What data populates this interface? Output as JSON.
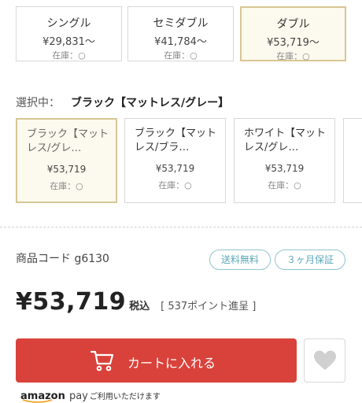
{
  "size_options": [
    {
      "name": "シングル",
      "price": "¥29,831〜",
      "stock": "在庫：○",
      "selected": false
    },
    {
      "name": "セミダブル",
      "price": "¥41,784〜",
      "stock": "在庫：○",
      "selected": false
    },
    {
      "name": "ダブル",
      "price": "¥53,719〜",
      "stock": "在庫：○",
      "selected": true
    }
  ],
  "selection": {
    "label": "選択中：",
    "value": "ブラック【マットレス/グレー】"
  },
  "color_options": [
    {
      "name": "ブラック【マットレス/グレ…",
      "price": "¥53,719",
      "stock": "在庫：○",
      "selected": true
    },
    {
      "name": "ブラック【マットレス/ブラ…",
      "price": "¥53,719",
      "stock": "在庫：○",
      "selected": false
    },
    {
      "name": "ホワイト【マットレス/グレ…",
      "price": "¥53,719",
      "stock": "在庫：○",
      "selected": false
    }
  ],
  "product": {
    "code": "商品コード g6130",
    "badges": [
      "送料無料",
      "３ヶ月保証"
    ],
    "price": "¥53,719",
    "tax": "税込",
    "points": "[ 537ポイント進呈 ]"
  },
  "cart": {
    "label": "カートに入れる",
    "icon": "cart-icon",
    "color": "#d9423b"
  },
  "favorite": {
    "icon": "heart-icon"
  },
  "amazon_pay": {
    "brand": "amazon",
    "pay": "pay",
    "note": "ご利用いただけます"
  },
  "colors": {
    "selected_border": "#d7c694",
    "selected_bg": "#fcfaee",
    "badge": "#5da8b8"
  }
}
